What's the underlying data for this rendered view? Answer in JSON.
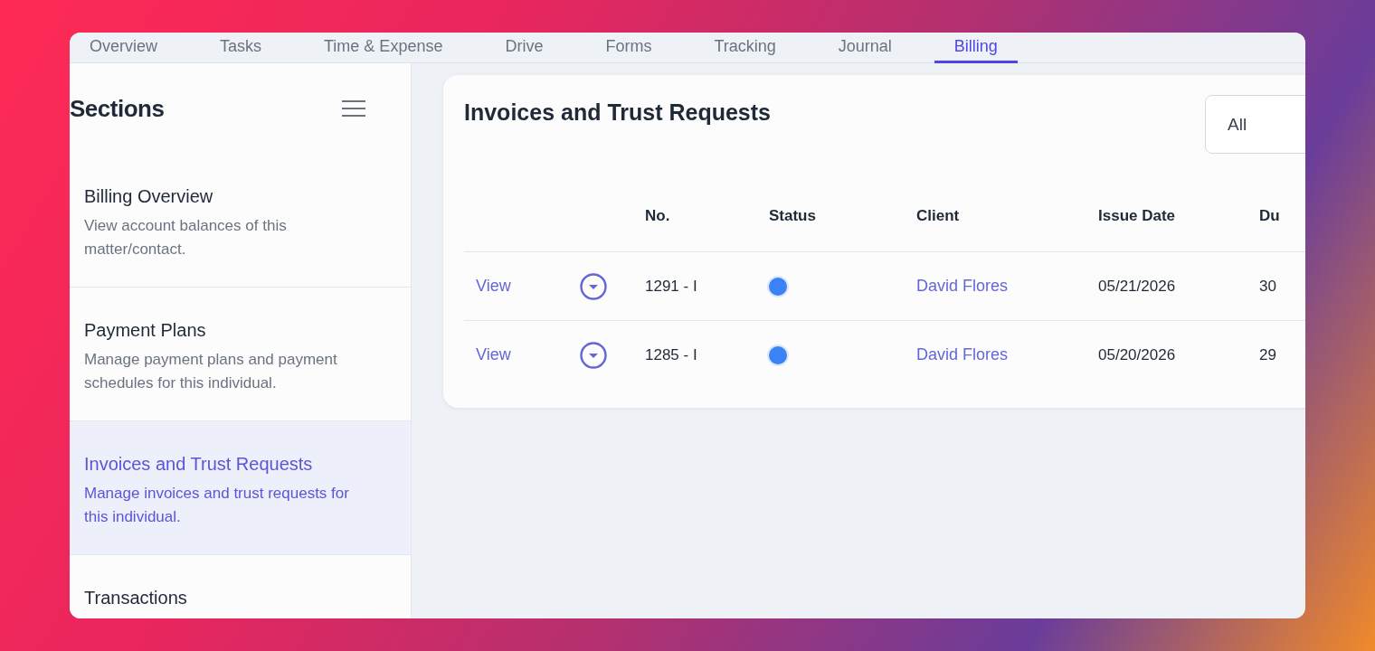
{
  "tabs": [
    {
      "label": "Overview",
      "selected": false
    },
    {
      "label": "Tasks",
      "selected": false
    },
    {
      "label": "Time & Expense",
      "selected": false
    },
    {
      "label": "Drive",
      "selected": false
    },
    {
      "label": "Forms",
      "selected": false
    },
    {
      "label": "Tracking",
      "selected": false
    },
    {
      "label": "Journal",
      "selected": false
    },
    {
      "label": "Billing",
      "selected": true
    }
  ],
  "sidebar": {
    "title": "Sections",
    "items": [
      {
        "title": "Billing Overview",
        "description": "View account balances of this matter/contact.",
        "selected": false
      },
      {
        "title": "Payment Plans",
        "description": "Manage payment plans and payment schedules for this individual.",
        "selected": false
      },
      {
        "title": "Invoices and Trust Requests",
        "description": "Manage invoices and trust requests for this individual.",
        "selected": true
      },
      {
        "title": "Transactions",
        "selected": false
      }
    ]
  },
  "panel": {
    "title": "Invoices and Trust Requests",
    "filter": {
      "value": "All"
    },
    "table": {
      "columns": [
        "No.",
        "Status",
        "Client",
        "Issue Date",
        "Du"
      ],
      "rows": [
        {
          "action": "View",
          "number": "1291 - I",
          "color": "#3b82f6",
          "client": "David Flores",
          "issue_date": "05/21/2026",
          "column_7": "30"
        },
        {
          "action": "View",
          "number": "1285 - I",
          "color": "#3b82f6",
          "client": "David Flores",
          "issue_date": "05/20/2026",
          "column_7": "29"
        }
      ]
    }
  }
}
